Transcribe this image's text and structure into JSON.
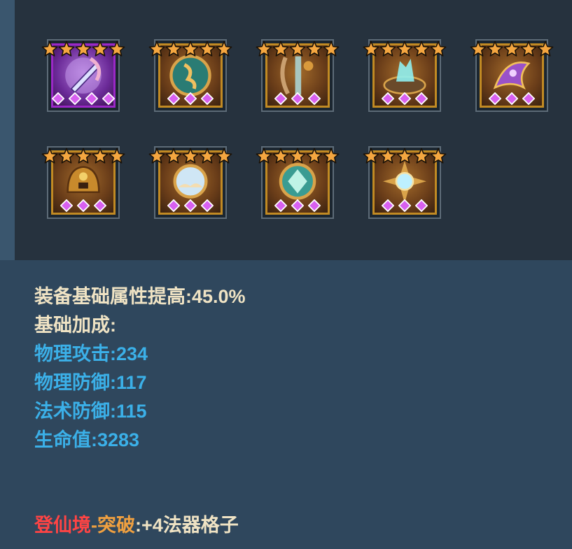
{
  "colors": {
    "background": "#2f475d",
    "panel": "#26323e",
    "gold_frame": "#c18a23",
    "purple_frame": "#9a28c6",
    "star": "#f4a640",
    "gem": "#d860f0",
    "text_beige": "#efe3c4",
    "text_blue": "#3bb0e8",
    "text_red": "#ff4444",
    "text_orange": "#f0a040"
  },
  "items": [
    {
      "icon": "purple-blade-icon",
      "rarity": "purple",
      "stars": 5,
      "gems": 4
    },
    {
      "icon": "jade-glyph-icon",
      "rarity": "gold",
      "stars": 5,
      "gems": 3
    },
    {
      "icon": "bronze-scepter-icon",
      "rarity": "gold",
      "stars": 5,
      "gems": 3
    },
    {
      "icon": "crystal-bowl-icon",
      "rarity": "gold",
      "stars": 5,
      "gems": 3
    },
    {
      "icon": "violet-dragon-relic-icon",
      "rarity": "gold",
      "stars": 5,
      "gems": 3
    },
    {
      "icon": "golden-helm-icon",
      "rarity": "gold",
      "stars": 5,
      "gems": 3
    },
    {
      "icon": "cloud-orb-icon",
      "rarity": "gold",
      "stars": 5,
      "gems": 3
    },
    {
      "icon": "teal-diamond-orb-icon",
      "rarity": "gold",
      "stars": 5,
      "gems": 3
    },
    {
      "icon": "radiant-sun-orb-icon",
      "rarity": "gold",
      "stars": 5,
      "gems": 3
    }
  ],
  "stats": {
    "equip_bonus": "装备基础属性提高:45.0%",
    "base_header": "基础加成:",
    "phys_attack": "物理攻击:234",
    "phys_defense": "物理防御:117",
    "magic_defense": "法术防御:115",
    "hp": "生命值:3283"
  },
  "breakthrough": {
    "realm": "登仙境",
    "dash": "-",
    "action": "突破",
    "effect": ":+4法器格子"
  }
}
